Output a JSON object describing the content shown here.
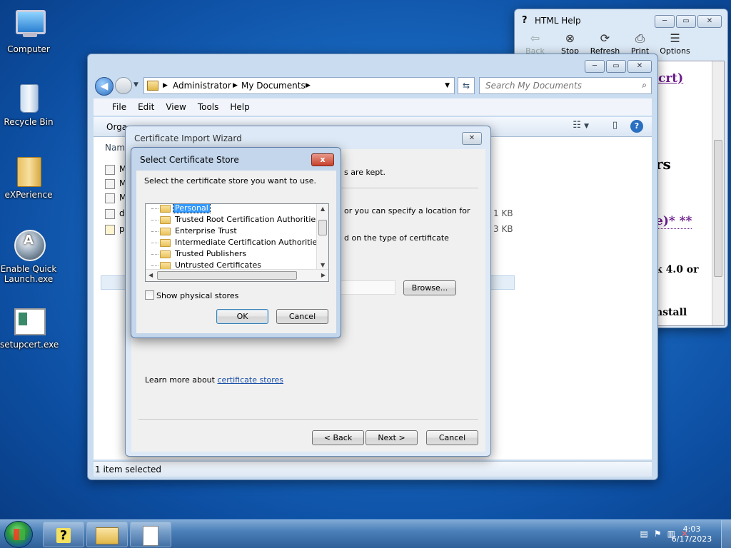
{
  "desktop": {
    "icons": [
      {
        "label": "Computer"
      },
      {
        "label": "Recycle Bin"
      },
      {
        "label": "eXPerience"
      },
      {
        "label": "Enable Quick Launch.exe"
      },
      {
        "label": "setupcert.exe"
      }
    ]
  },
  "help_window": {
    "title": "HTML Help",
    "toolbar": [
      {
        "label": "Back",
        "icon": "back-arrow-icon",
        "enabled": false
      },
      {
        "label": "Stop",
        "icon": "stop-icon",
        "enabled": true
      },
      {
        "label": "Refresh",
        "icon": "refresh-icon",
        "enabled": true
      },
      {
        "label": "Print",
        "icon": "printer-icon",
        "enabled": true
      },
      {
        "label": "Options",
        "icon": "options-icon",
        "enabled": true
      }
    ],
    "body_fragments": [
      "crt)",
      "rs",
      "e)* **",
      "k 4.0 or",
      "nstall"
    ]
  },
  "explorer": {
    "breadcrumb": [
      "Administrator",
      "My Documents"
    ],
    "search_placeholder": "Search My Documents",
    "menu": [
      "File",
      "Edit",
      "View",
      "Tools",
      "Help"
    ],
    "organize_label": "Orga",
    "column_header": "Nam",
    "files": [
      {
        "name": "M"
      },
      {
        "name": "M"
      },
      {
        "name": "M"
      },
      {
        "name": "d",
        "size": "1 KB"
      },
      {
        "name": "p",
        "size": "3 KB",
        "selected": true
      }
    ],
    "status": "1 item selected"
  },
  "wizard": {
    "title": "Certificate Import Wizard",
    "text_kept": "s are kept.",
    "text_location": "or you can specify a location for",
    "text_type": "d on the type of certificate",
    "browse_label": "Browse...",
    "learn_more_prefix": "Learn more about ",
    "learn_more_link": "certificate stores",
    "back_label": "< Back",
    "next_label": "Next >",
    "cancel_label": "Cancel"
  },
  "store_dialog": {
    "title": "Select Certificate Store",
    "close_label": "x",
    "instruction": "Select the certificate store you want to use.",
    "stores": [
      {
        "label": "Personal",
        "selected": true
      },
      {
        "label": "Trusted Root Certification Authorities"
      },
      {
        "label": "Enterprise Trust"
      },
      {
        "label": "Intermediate Certification Authorities"
      },
      {
        "label": "Trusted Publishers"
      },
      {
        "label": "Untrusted Certificates"
      }
    ],
    "show_physical_label": "Show physical stores",
    "show_physical_checked": false,
    "ok_label": "OK",
    "cancel_label": "Cancel"
  },
  "taskbar": {
    "time": "4:03",
    "date": "6/17/2023"
  }
}
